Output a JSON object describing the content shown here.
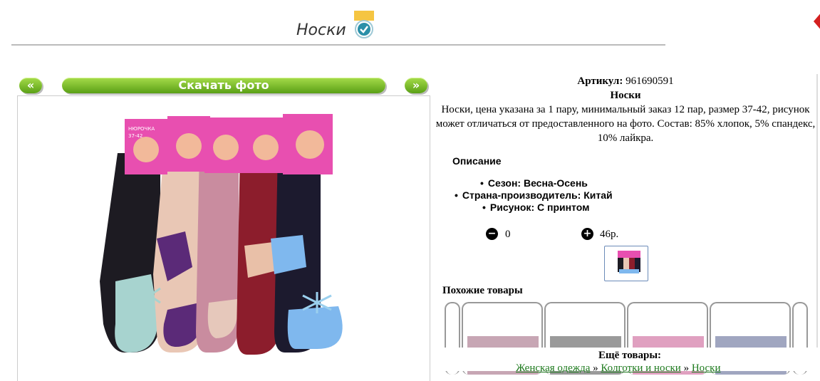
{
  "header": {
    "title": "Носки"
  },
  "photo_nav": {
    "prev_label": "«",
    "download_label": "Скачать фото",
    "next_label": "»"
  },
  "product": {
    "article_label": "Артикул:",
    "article_value": "961690591",
    "name": "Носки",
    "description": "Носки, цена указана за 1 пару, минимальный заказ 12 пар, размер 37-42, рисунок может отличаться от предоставленного на фото. Состав: 85% хлопок, 5% спандекс, 10% лайкра.",
    "description_heading": "Описание",
    "properties": [
      "Сезон: Весна-Осень",
      "Страна-производитель: Китай",
      "Рисунок: С принтом"
    ],
    "quantity": "0",
    "price": "46р."
  },
  "photo_pack_text": {
    "brand": "НЮРОЧКА",
    "size": "37-42"
  },
  "similar": {
    "heading": "Похожие товары"
  },
  "more": {
    "heading": "Ещё товары:",
    "breadcrumb": [
      "Женская одежда",
      "Колготки и носки",
      "Носки"
    ],
    "separator": "»"
  },
  "colors": {
    "accent_green": "#6ab41e",
    "link_green": "#1d7a1d",
    "sock_colors": [
      "#1d1b22",
      "#e9c7b5",
      "#c98c9f",
      "#8c1d2c",
      "#1c1a2e"
    ]
  }
}
